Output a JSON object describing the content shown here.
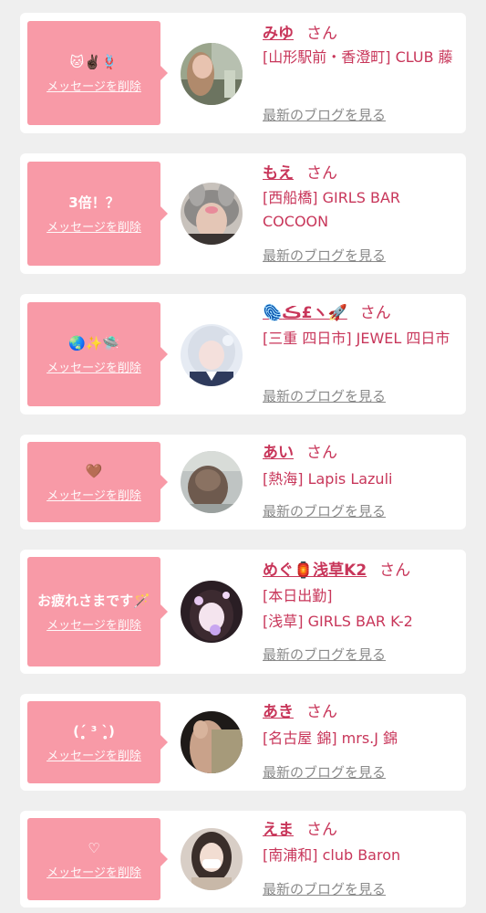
{
  "theme": {
    "accent": "#f89aa7",
    "name_color": "#c8365a",
    "link_color": "#8a8a8a",
    "background": "#efefef"
  },
  "delete_label": "メッセージを削除",
  "blog_label": "最新のブログを見る",
  "honorific": "さん",
  "cards": [
    {
      "message": "🐱✌🏿🪢",
      "name": "みゆ",
      "name_extra": "",
      "shop": "[山形駅前・香澄町] CLUB 藤",
      "avatar": "photo-street"
    },
    {
      "message": "3倍！？",
      "name": "もえ",
      "name_extra": "",
      "shop": "[西船橋] GIRLS BAR COCOON",
      "avatar": "photo-bunny-filter"
    },
    {
      "message": "🌏✨🛸",
      "name": "🫆ڪ£ヽ🚀",
      "name_extra": "",
      "shop": "[三重 四日市] JEWEL 四日市",
      "avatar": "photo-silver-hair"
    },
    {
      "message": "🤎",
      "name": "あい",
      "name_extra": "",
      "shop": "[熱海] Lapis Lazuli",
      "avatar": "photo-hair-back"
    },
    {
      "message": "お疲れさまです🪄",
      "name": "めぐ🏮浅草K2",
      "name_extra": "[本日出勤]",
      "shop": "[浅草] GIRLS BAR K-2",
      "avatar": "photo-sparkle"
    },
    {
      "message": "(ˊ̥̥̥̥̥ ³ ˋ̥̥̥̥̥)",
      "name": "あき",
      "name_extra": "",
      "shop": "[名古屋 錦] mrs.J 錦",
      "avatar": "photo-legs"
    },
    {
      "message": "♡",
      "name": "えま",
      "name_extra": "",
      "shop": "[南浦和] club Baron",
      "avatar": "photo-mask"
    }
  ]
}
